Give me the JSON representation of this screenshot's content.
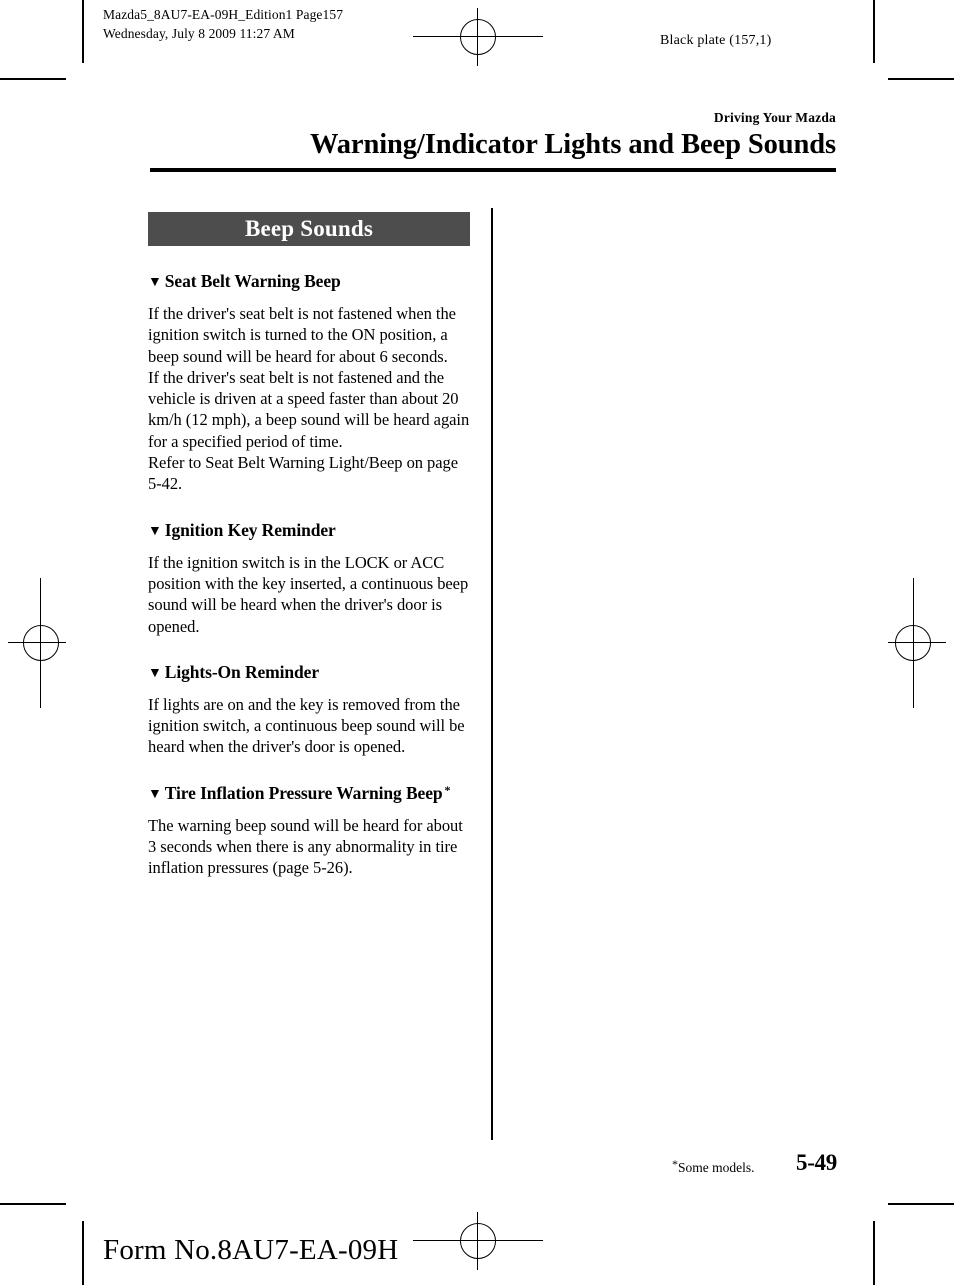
{
  "slug": {
    "file_info": "Mazda5_8AU7-EA-09H_Edition1 Page157\nWednesday, July 8 2009 11:27 AM",
    "plate_info": "Black plate (157,1)"
  },
  "header": {
    "eyebrow": "Driving Your Mazda",
    "title": "Warning/Indicator Lights and Beep Sounds"
  },
  "content": {
    "banner": "Beep Sounds",
    "sections": [
      {
        "marker": "▼",
        "heading": "Seat Belt Warning Beep",
        "asterisk": "",
        "body": "If the driver's seat belt is not fastened when the ignition switch is turned to the ON position, a beep sound will be heard for about 6 seconds.\nIf the driver's seat belt is not fastened and the vehicle is driven at a speed faster than about 20 km/h (12 mph), a beep sound will be heard again for a specified period of time.\nRefer to Seat Belt Warning Light/Beep on page 5-42."
      },
      {
        "marker": "▼",
        "heading": "Ignition Key Reminder",
        "asterisk": "",
        "body": "If the ignition switch is in the LOCK or ACC position with the key inserted, a continuous beep sound will be heard when the driver's door is opened."
      },
      {
        "marker": "▼",
        "heading": "Lights-On Reminder",
        "asterisk": "",
        "body": "If lights are on and the key is removed from the ignition switch, a continuous beep sound will be heard when the driver's door is opened."
      },
      {
        "marker": "▼",
        "heading": "Tire Inflation Pressure Warning Beep",
        "asterisk": "*",
        "body": "The warning beep sound will be heard for about 3 seconds when there is any abnormality in tire inflation pressures (page 5-26)."
      }
    ]
  },
  "footer": {
    "footnote_marker": "*",
    "footnote": "Some models.",
    "page_number": "5-49",
    "form_number": "Form No.8AU7-EA-09H"
  },
  "colors": {
    "banner_background": "#4d4d4d",
    "banner_text": "#ffffff",
    "rule": "#000000",
    "page_background": "#ffffff"
  }
}
